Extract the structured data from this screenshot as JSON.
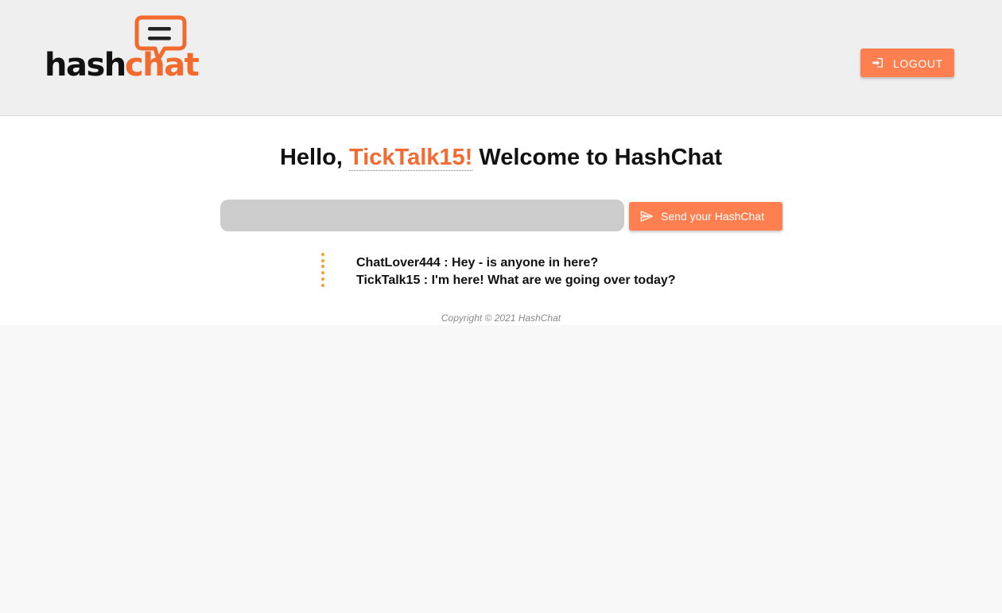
{
  "header": {
    "logo": {
      "text_left": "hash",
      "text_right": "chat",
      "colors": {
        "dark": "#111111",
        "accent": "#f26a2e"
      }
    },
    "logout_label": "LOGOUT",
    "logout_icon": "login-icon"
  },
  "greeting": {
    "prefix": "Hello,",
    "username": "TickTalk15!",
    "suffix": "Welcome to HashChat"
  },
  "composer": {
    "input_value": "",
    "input_placeholder": "",
    "send_label": "Send your HashChat",
    "send_icon": "send-icon"
  },
  "messages": [
    {
      "text": "ChatLover444 : Hey - is anyone in here?"
    },
    {
      "text": "TickTalk15 : I'm here! What are we going over today?"
    }
  ],
  "footer": {
    "copyright": "Copyright © 2021 HashChat"
  },
  "theme": {
    "accent": "#ff7f50",
    "username_color": "#f56a32",
    "dots_color": "#f5a031",
    "header_bg": "#efefef",
    "input_bg": "#cccccc"
  }
}
